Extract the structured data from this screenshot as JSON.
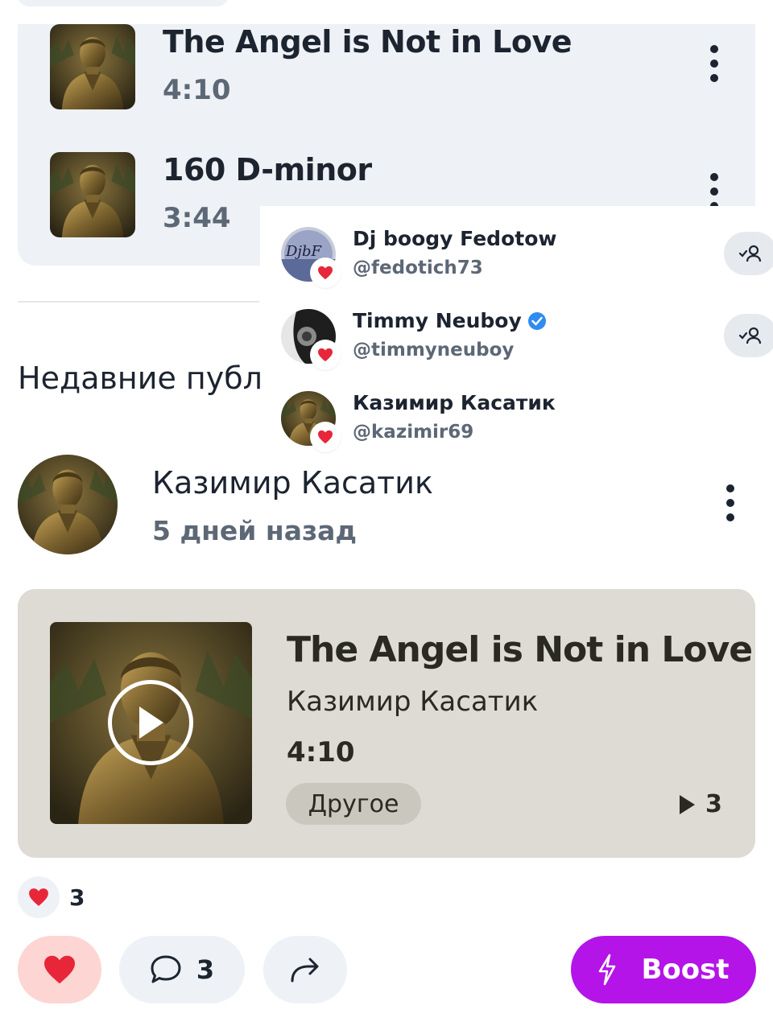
{
  "tracks": [
    {
      "title": "The Angel is Not in Love",
      "duration": "4:10",
      "cover_icon": "bronze-statue-cover"
    },
    {
      "title": "160 D-minor",
      "duration": "3:44",
      "cover_icon": "bronze-statue-cover"
    }
  ],
  "likers_popup": {
    "items": [
      {
        "name": "Dj boogy Fedotow",
        "handle": "@fedotich73",
        "verified": false,
        "avatar_text": "DjbF",
        "follow_icon": "followed-user-icon"
      },
      {
        "name": "Timmy Neuboy",
        "handle": "@timmyneuboy",
        "verified": true,
        "avatar_text": "",
        "follow_icon": "followed-user-icon"
      },
      {
        "name": "Казимир Касатик",
        "handle": "@kazimir69",
        "verified": false,
        "avatar_text": "",
        "follow_icon": ""
      }
    ]
  },
  "section": {
    "title": "Недавние публикации"
  },
  "post": {
    "author": "Казимир Касатик",
    "time": "5 дней назад",
    "player": {
      "title": "The Angel is Not in Love",
      "artist": "Казимир Касатик",
      "duration": "4:10",
      "genre": "Другое",
      "plays": "3"
    },
    "likes_count": "3",
    "comments_count": "3",
    "boost_label": "Boost"
  },
  "colors": {
    "accent_boost": "#b414e8",
    "heart_red": "#e8263a",
    "verified_blue": "#2f8cf0",
    "card_grey": "#eef1f5",
    "player_bg": "#dddbd4"
  }
}
